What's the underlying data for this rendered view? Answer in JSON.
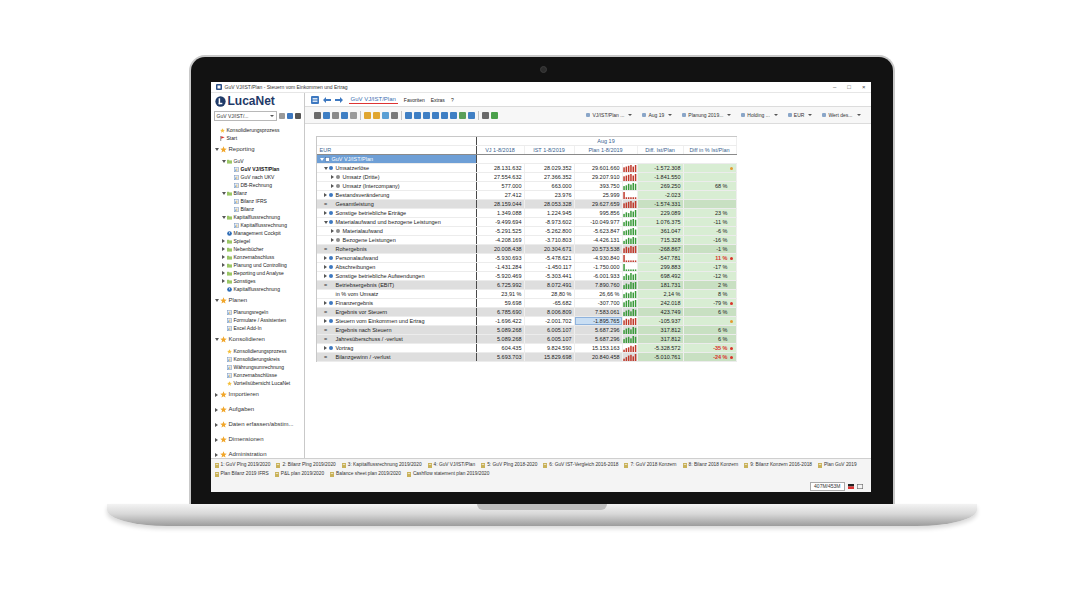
{
  "window": {
    "title": "GuV VJ/IST/Plan - Steuern vom Einkommen und Ertrag",
    "controls": [
      "–",
      "□",
      "×"
    ]
  },
  "logo": "LucaNet",
  "sidebar": {
    "report_selector": "GuV VJ/IST/...",
    "items": [
      {
        "label": "Konsolidierungsprozess",
        "level": 0,
        "kind": "process",
        "expandable": false,
        "expanded": false,
        "selected": false
      },
      {
        "label": "Start",
        "level": 0,
        "kind": "flag",
        "expandable": false,
        "expanded": false,
        "selected": false
      },
      {
        "label": "Reporting",
        "level": 0,
        "kind": "section",
        "expandable": true,
        "expanded": true,
        "selected": false
      },
      {
        "label": "GuV",
        "level": 1,
        "kind": "folder",
        "expandable": true,
        "expanded": true,
        "selected": false
      },
      {
        "label": "GuV VJ/IST/Plan",
        "level": 2,
        "kind": "report",
        "expandable": false,
        "expanded": false,
        "selected": true
      },
      {
        "label": "GuV nach UKV",
        "level": 2,
        "kind": "report",
        "expandable": false,
        "expanded": false,
        "selected": false
      },
      {
        "label": "DB-Rechnung",
        "level": 2,
        "kind": "report",
        "expandable": false,
        "expanded": false,
        "selected": false
      },
      {
        "label": "Bilanz",
        "level": 1,
        "kind": "folder",
        "expandable": true,
        "expanded": true,
        "selected": false
      },
      {
        "label": "Bilanz IFRS",
        "level": 2,
        "kind": "report",
        "expandable": false,
        "expanded": false,
        "selected": false
      },
      {
        "label": "Bilanz",
        "level": 2,
        "kind": "report",
        "expandable": false,
        "expanded": false,
        "selected": false
      },
      {
        "label": "Kapitalflussrechnung",
        "level": 1,
        "kind": "folder",
        "expandable": true,
        "expanded": true,
        "selected": false
      },
      {
        "label": "Kapitalflussrechnung",
        "level": 2,
        "kind": "report",
        "expandable": false,
        "expanded": false,
        "selected": false
      },
      {
        "label": "Management Cockpit",
        "level": 1,
        "kind": "cockpit",
        "expandable": false,
        "expanded": false,
        "selected": false
      },
      {
        "label": "Spiegel",
        "level": 1,
        "kind": "folder",
        "expandable": true,
        "expanded": false,
        "selected": false
      },
      {
        "label": "Nebenbücher",
        "level": 1,
        "kind": "folder",
        "expandable": true,
        "expanded": false,
        "selected": false
      },
      {
        "label": "Konzernabschluss",
        "level": 1,
        "kind": "folder",
        "expandable": true,
        "expanded": false,
        "selected": false
      },
      {
        "label": "Planung und Controlling",
        "level": 1,
        "kind": "folder",
        "expandable": true,
        "expanded": false,
        "selected": false
      },
      {
        "label": "Reporting und Analyse",
        "level": 1,
        "kind": "folder",
        "expandable": true,
        "expanded": false,
        "selected": false
      },
      {
        "label": "Sonstiges",
        "level": 1,
        "kind": "folder",
        "expandable": true,
        "expanded": false,
        "selected": false
      },
      {
        "label": "Kapitalflussrechnung",
        "level": 1,
        "kind": "cockpit",
        "expandable": false,
        "expanded": false,
        "selected": false
      },
      {
        "label": "Planen",
        "level": 0,
        "kind": "section",
        "expandable": true,
        "expanded": true,
        "selected": false
      },
      {
        "label": "Planungsregeln",
        "level": 1,
        "kind": "report",
        "expandable": false,
        "expanded": false,
        "selected": false
      },
      {
        "label": "Formulare / Assistenten",
        "level": 1,
        "kind": "report",
        "expandable": false,
        "expanded": false,
        "selected": false
      },
      {
        "label": "Excel Add-In",
        "level": 1,
        "kind": "report",
        "expandable": false,
        "expanded": false,
        "selected": false
      },
      {
        "label": "Konsolidieren",
        "level": 0,
        "kind": "section",
        "expandable": true,
        "expanded": true,
        "selected": false
      },
      {
        "label": "Konsolidierungsprozess",
        "level": 1,
        "kind": "process",
        "expandable": false,
        "expanded": false,
        "selected": false
      },
      {
        "label": "Konsolidierungskreis",
        "level": 1,
        "kind": "report",
        "expandable": false,
        "expanded": false,
        "selected": false
      },
      {
        "label": "Währungsumrechnung",
        "level": 1,
        "kind": "report",
        "expandable": false,
        "expanded": false,
        "selected": false
      },
      {
        "label": "Konzernabschlüsse",
        "level": 1,
        "kind": "report",
        "expandable": false,
        "expanded": false,
        "selected": false
      },
      {
        "label": "Vorteilsübersicht LucaNet",
        "level": 1,
        "kind": "process",
        "expandable": false,
        "expanded": false,
        "selected": false
      },
      {
        "label": "Importieren",
        "level": 0,
        "kind": "section",
        "expandable": true,
        "expanded": false,
        "selected": false
      },
      {
        "label": "Aufgaben",
        "level": 0,
        "kind": "section",
        "expandable": true,
        "expanded": false,
        "selected": false
      },
      {
        "label": "Daten erfassen/abstim...",
        "level": 0,
        "kind": "section",
        "expandable": true,
        "expanded": false,
        "selected": false
      },
      {
        "label": "Dimensionen",
        "level": 0,
        "kind": "section",
        "expandable": true,
        "expanded": false,
        "selected": false
      },
      {
        "label": "Administration",
        "level": 0,
        "kind": "section",
        "expandable": true,
        "expanded": false,
        "selected": false
      }
    ]
  },
  "nav": {
    "tabs": [
      {
        "label": "GuV VJ/IST/Plan",
        "selected": true
      }
    ],
    "menu": [
      "Favoriten",
      "Extras",
      "?"
    ]
  },
  "toolbar": {
    "dropdowns": [
      "VJ/IST/Plan ...",
      "Aug 19",
      "Planung 2019...",
      "Holding ...",
      "EUR",
      "Wert des..."
    ]
  },
  "table": {
    "unit": "EUR",
    "period": "Aug 19",
    "columns": [
      "VJ 1-8/2018",
      "IST 1-8/2019",
      "Plan 1-8/2019",
      "Diff. Ist/Plan",
      "Diff in % Ist/Plan"
    ],
    "root": {
      "label": "GuV VJ/IST/Plan",
      "expanded": true,
      "selected": true
    },
    "rows": [
      {
        "label": "Umsatzerlöse",
        "kind": "group",
        "level": 1,
        "expanded": true,
        "selected": false,
        "vj": "28.131.632",
        "ist": "28.029.352",
        "plan": "29.601.660",
        "diff": "-1.572.308",
        "pct": "",
        "alert": false,
        "spark": [
          6,
          7,
          8,
          9,
          7,
          9
        ],
        "spark_color": "#c0392b",
        "flag_color": "#e39b32"
      },
      {
        "label": "Umsatz (Dritte)",
        "kind": "item",
        "level": 2,
        "expanded": false,
        "selected": false,
        "vj": "27.554.632",
        "ist": "27.366.352",
        "plan": "29.207.910",
        "diff": "-1.841.550",
        "pct": "",
        "alert": false,
        "spark": [
          6,
          7,
          8,
          9,
          7,
          9
        ],
        "spark_color": "#c0392b"
      },
      {
        "label": "Umsatz (Intercompany)",
        "kind": "item",
        "level": 2,
        "expanded": false,
        "selected": false,
        "vj": "577.000",
        "ist": "663.000",
        "plan": "393.750",
        "diff": "269.250",
        "pct": "68 %",
        "alert": false,
        "spark": [
          5,
          6,
          8,
          7,
          9,
          8
        ],
        "spark_color": "#3a9a3a"
      },
      {
        "label": "Bestandsveränderung",
        "kind": "group",
        "level": 1,
        "expanded": false,
        "selected": false,
        "vj": "27.412",
        "ist": "23.976",
        "plan": "25.999",
        "diff": "-2.023",
        "pct": "",
        "alert": false,
        "spark": [
          8,
          2,
          2,
          2,
          2,
          2
        ],
        "spark_color": "#c0392b"
      },
      {
        "label": "Gesamtleistung",
        "kind": "sum",
        "sign": "=",
        "level": 1,
        "selected": false,
        "vj": "28.159.044",
        "ist": "28.053.328",
        "plan": "29.627.659",
        "diff": "-1.574.331",
        "pct": "",
        "alert": false,
        "spark": [
          6,
          7,
          8,
          9,
          7,
          9
        ],
        "spark_color": "#c0392b"
      },
      {
        "label": "Sonstige betriebliche Erträge",
        "kind": "group",
        "level": 1,
        "expanded": false,
        "selected": false,
        "vj": "1.349.088",
        "ist": "1.224.945",
        "plan": "995.856",
        "diff": "229.089",
        "pct": "23 %",
        "alert": false,
        "spark": [
          4,
          6,
          5,
          8,
          7,
          9
        ],
        "spark_color": "#3a9a3a"
      },
      {
        "label": "Materialaufwand und bezogene Leistungen",
        "kind": "group",
        "level": 1,
        "expanded": true,
        "selected": false,
        "vj": "-9.499.694",
        "ist": "-8.973.602",
        "plan": "-10.049.977",
        "diff": "1.076.375",
        "pct": "-11 %",
        "alert": false,
        "spark": [
          5,
          7,
          6,
          8,
          9,
          8
        ],
        "spark_color": "#3a9a3a"
      },
      {
        "label": "Materialaufwand",
        "kind": "item",
        "level": 2,
        "expanded": false,
        "selected": false,
        "vj": "-5.291.525",
        "ist": "-5.262.800",
        "plan": "-5.623.847",
        "diff": "361.047",
        "pct": "-6 %",
        "alert": false,
        "spark": [
          5,
          6,
          7,
          8,
          9,
          7
        ],
        "spark_color": "#3a9a3a"
      },
      {
        "label": "Bezogene Leistungen",
        "kind": "item",
        "level": 2,
        "expanded": false,
        "selected": false,
        "vj": "-4.208.169",
        "ist": "-3.710.803",
        "plan": "-4.426.131",
        "diff": "715.328",
        "pct": "-16 %",
        "alert": false,
        "spark": [
          4,
          6,
          8,
          7,
          9,
          8
        ],
        "spark_color": "#3a9a3a"
      },
      {
        "label": "Rohergebnis",
        "kind": "sum",
        "sign": "=",
        "level": 1,
        "selected": false,
        "vj": "20.008.438",
        "ist": "20.304.671",
        "plan": "20.573.538",
        "diff": "-268.867",
        "pct": "-1 %",
        "alert": false,
        "spark": [
          6,
          8,
          7,
          9,
          8,
          9
        ],
        "spark_color": "#c0392b"
      },
      {
        "label": "Personalaufwand",
        "kind": "group",
        "level": 1,
        "expanded": false,
        "selected": false,
        "vj": "-5.930.693",
        "ist": "-5.478.621",
        "plan": "-4.930.840",
        "diff": "-547.781",
        "pct": "11 %",
        "alert": true,
        "spark": [
          9,
          2,
          2,
          2,
          2,
          2
        ],
        "spark_color": "#c0392b",
        "flag_color": "#d9342b"
      },
      {
        "label": "Abschreibungen",
        "kind": "group",
        "level": 1,
        "expanded": false,
        "selected": false,
        "vj": "-1.431.284",
        "ist": "-1.450.117",
        "plan": "-1.750.000",
        "diff": "299.883",
        "pct": "-17 %",
        "alert": false,
        "spark": [
          9,
          2,
          2,
          2,
          2,
          2
        ],
        "spark_color": "#3a9a3a"
      },
      {
        "label": "Sonstige betriebliche Aufwendungen",
        "kind": "group",
        "level": 1,
        "expanded": false,
        "selected": false,
        "vj": "-5.920.469",
        "ist": "-5.303.441",
        "plan": "-6.001.933",
        "diff": "698.492",
        "pct": "-12 %",
        "alert": false,
        "spark": [
          5,
          8,
          6,
          9,
          7,
          8
        ],
        "spark_color": "#3a9a3a"
      },
      {
        "label": "Betriebsergebnis (EBIT)",
        "kind": "sum",
        "sign": "=",
        "level": 1,
        "selected": false,
        "vj": "6.725.992",
        "ist": "8.072.491",
        "plan": "7.890.760",
        "diff": "181.731",
        "pct": "2 %",
        "alert": false,
        "spark": [
          5,
          7,
          6,
          9,
          8,
          9
        ],
        "spark_color": "#3a9a3a"
      },
      {
        "label": "in % vom Umsatz",
        "kind": "ratio",
        "level": 1,
        "selected": false,
        "vj": "23,91 %",
        "ist": "28,80 %",
        "plan": "26,66 %",
        "diff": "2,14 %",
        "pct": "8 %",
        "alert": false,
        "spark": [
          5,
          7,
          6,
          8,
          7,
          9
        ],
        "spark_color": "#3a9a3a"
      },
      {
        "label": "Finanzergebnis",
        "kind": "group",
        "level": 1,
        "expanded": false,
        "selected": false,
        "vj": "59.698",
        "ist": "-65.682",
        "plan": "-307.700",
        "diff": "242.018",
        "pct": "-79 %",
        "alert": false,
        "spark": [
          6,
          8,
          9,
          7,
          8,
          9
        ],
        "spark_color": "#3a9a3a",
        "flag_color": "#d9342b"
      },
      {
        "label": "Ergebnis vor Steuern",
        "kind": "sum",
        "sign": "=",
        "level": 1,
        "selected": false,
        "vj": "6.785.690",
        "ist": "8.006.809",
        "plan": "7.583.061",
        "diff": "423.749",
        "pct": "6 %",
        "alert": false,
        "spark": [
          5,
          7,
          8,
          6,
          9,
          8
        ],
        "spark_color": "#3a9a3a"
      },
      {
        "label": "Steuern vom Einkommen und Ertrag",
        "kind": "group",
        "level": 1,
        "expanded": false,
        "selected": true,
        "vj": "-1.696.422",
        "ist": "-2.001.702",
        "plan": "-1.895.765",
        "diff": "-105.937",
        "pct": "",
        "alert": false,
        "spark": [
          6,
          8,
          7,
          9,
          8,
          9
        ],
        "spark_color": "#c0392b",
        "flag_color": "#e39b32"
      },
      {
        "label": "Ergebnis nach Steuern",
        "kind": "sum",
        "sign": "=",
        "level": 1,
        "selected": false,
        "vj": "5.089.268",
        "ist": "6.005.107",
        "plan": "5.687.296",
        "diff": "317.812",
        "pct": "6 %",
        "alert": false,
        "spark": [
          5,
          7,
          8,
          6,
          9,
          8
        ],
        "spark_color": "#3a9a3a"
      },
      {
        "label": "Jahresüberschuss / -verlust",
        "kind": "sum",
        "sign": "=",
        "level": 1,
        "selected": false,
        "vj": "5.089.268",
        "ist": "6.005.107",
        "plan": "5.687.296",
        "diff": "317.812",
        "pct": "6 %",
        "alert": false,
        "spark": [
          5,
          7,
          8,
          6,
          9,
          8
        ],
        "spark_color": "#3a9a3a"
      },
      {
        "label": "Vortrag",
        "kind": "group",
        "level": 1,
        "expanded": false,
        "selected": false,
        "vj": "604.435",
        "ist": "9.824.590",
        "plan": "15.153.163",
        "diff": "-5.328.572",
        "pct": "-35 %",
        "alert": true,
        "spark": [
          3,
          5,
          6,
          8,
          7,
          9
        ],
        "spark_color": "#c0392b",
        "flag_color": "#d9342b"
      },
      {
        "label": "Bilanzgewinn / -verlust",
        "kind": "sum",
        "sign": "=",
        "level": 1,
        "selected": false,
        "vj": "5.693.703",
        "ist": "15.829.698",
        "plan": "20.840.458",
        "diff": "-5.010.761",
        "pct": "-24 %",
        "alert": true,
        "spark": [
          3,
          5,
          7,
          8,
          6,
          9
        ],
        "spark_color": "#c0392b",
        "flag_color": "#d9342b"
      }
    ]
  },
  "bottom_tabs": [
    {
      "label": "1: GuV Plng 2019/2020",
      "selected": false
    },
    {
      "label": "2: Bilanz Plng 2019/2020",
      "selected": false
    },
    {
      "label": "3: Kapitalflussrechnung 2019/2020",
      "selected": false
    },
    {
      "label": "4: GuV VJ/IST/Plan",
      "selected": false
    },
    {
      "label": "5: GuV Plng 2018-2020",
      "selected": false
    },
    {
      "label": "6: GuV IST-Vergleich 2016-2018",
      "selected": false
    },
    {
      "label": "7: GuV 2018 Konzern",
      "selected": false
    },
    {
      "label": "8: Bilanz 2018 Konzern",
      "selected": false
    },
    {
      "label": "9: Bilanz Konzern 2016-2018",
      "selected": false
    },
    {
      "label": "Plan GuV 2019",
      "selected": false
    },
    {
      "label": "Plan Bilanz 2019 IFRS",
      "selected": false
    },
    {
      "label": "P&L plan 2019/2020",
      "selected": false
    },
    {
      "label": "Balance sheet plan 2019/2020",
      "selected": false
    },
    {
      "label": "Cashflow statement plan 2019/2020",
      "selected": false
    }
  ],
  "status_bar": {
    "memory": "407M/453M"
  }
}
